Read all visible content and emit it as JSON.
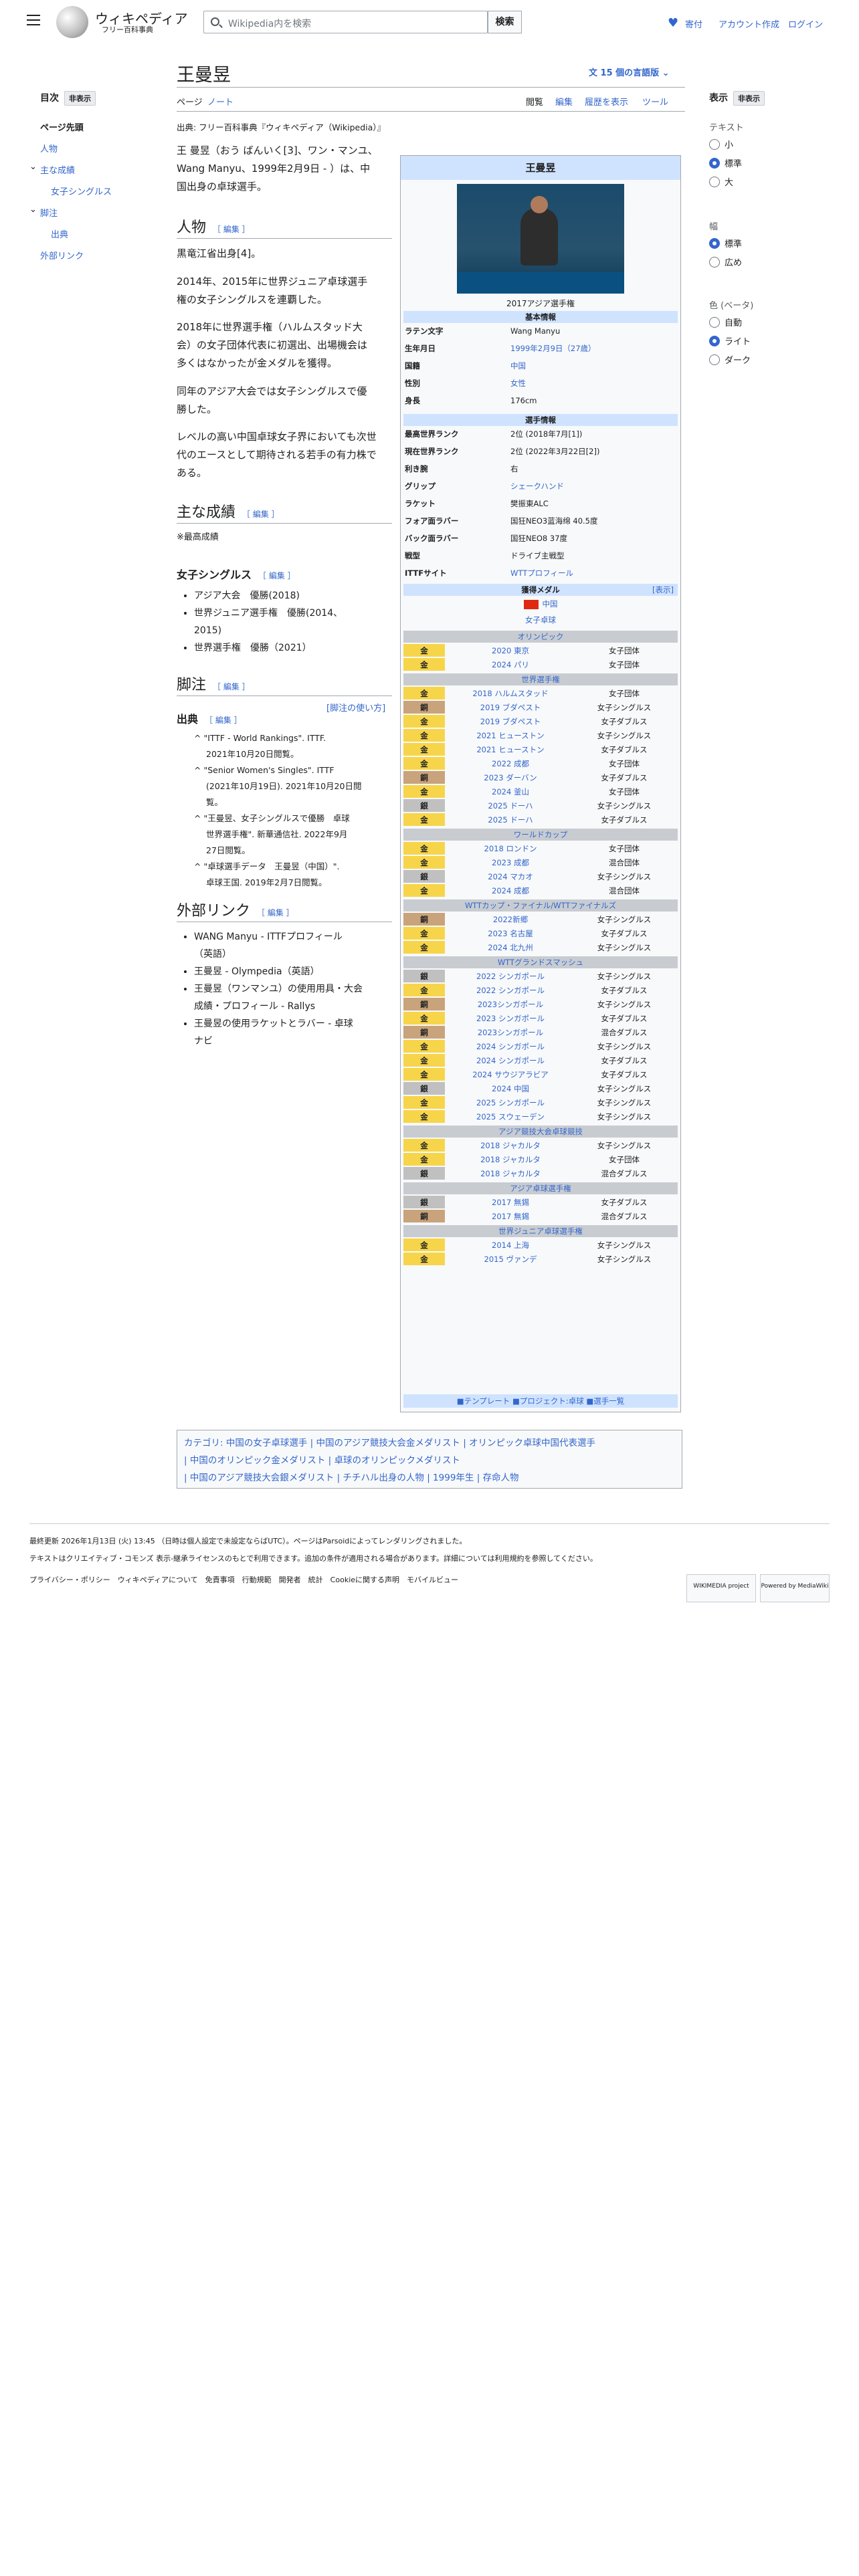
{
  "header": {
    "logo_title": "ウィキペディア",
    "logo_sub": "フリー百科事典",
    "search_placeholder": "Wikipedia内を検索",
    "search_btn": "検索",
    "donate": "寄付",
    "account": "アカウント作成",
    "login": "ログイン"
  },
  "toc": {
    "title": "目次",
    "hide": "非表示",
    "items": [
      "ページ先頭",
      "人物",
      "主な成績",
      "女子シングルス",
      "脚注",
      "出典",
      "外部リンク"
    ]
  },
  "page": {
    "title": "王曼昱",
    "languages": "15 個の言語版",
    "tabs": [
      "ページ",
      "ノート",
      "閲覧",
      "編集",
      "履歴を表示",
      "ツール"
    ],
    "from": "出典: フリー百科事典『ウィキペディア（Wikipedia）』"
  },
  "intro": [
    "王 曼昱（おう ばんいく[3]、ワン・マンユ、",
    "Wang Manyu、1999年2月9日 - ）は、中",
    "国出身の卓球選手。"
  ],
  "sections": {
    "jinbutsu": "人物",
    "edit": "［ 編集 ］",
    "p1": "黒竜江省出身[4]。",
    "p2": [
      "2014年、2015年に世界ジュニア卓球選手",
      "権の女子シングルスを連覇した。"
    ],
    "p3": [
      "2018年に世界選手権（ハルムスタッド大",
      "会）の女子団体代表に初選出、出場機会は",
      "多くはなかったが金メダルを獲得。"
    ],
    "p4": [
      "同年のアジア大会では女子シングルスで優",
      "勝した。"
    ],
    "p5": [
      "レベルの高い中国卓球女子界においても次世",
      "代のエースとして期待される若手の有力株で",
      "ある。"
    ],
    "seiseki": "主な成績",
    "seiseki_note": "※最高成績",
    "singles": "女子シングルス",
    "singles_items": [
      "アジア大会　優勝(2018)",
      "世界ジュニア選手権　優勝(2014、",
      "2015)",
      "世界選手権　優勝（2021）"
    ],
    "kyakuchu": "脚注",
    "shuten": "出典",
    "howto": "[脚注の使い方]",
    "refs": [
      "^ \"ITTF - World Rankings\". ITTF.",
      "2021年10月20日閲覧。",
      "^ \"Senior Women's Singles\". ITTF",
      "(2021年10月19日). 2021年10月20日閲",
      "覧。",
      "^ \"王曼昱、女子シングルスで優勝　卓球",
      "世界選手権\". 新華通信社. 2022年9月",
      "27日閲覧。",
      "^ \"卓球選手データ　王曼昱（中国）\".",
      "卓球王国. 2019年2月7日閲覧。"
    ],
    "links": "外部リンク",
    "link_items": [
      "WANG Manyu - ITTFプロフィール",
      "（英語）",
      "王曼昱 - Olympedia（英語）",
      "王曼昱（ワンマンユ）の使用用具・大会",
      "成績・プロフィール - Rallys",
      "王曼昱の使用ラケットとラバー - 卓球",
      "ナビ"
    ]
  },
  "settings": {
    "title": "表示",
    "hide": "非表示",
    "text": "テキスト",
    "text_opts": [
      "小",
      "標準",
      "大"
    ],
    "width": "幅",
    "width_opts": [
      "標準",
      "広め"
    ],
    "color": "色 (ベータ)",
    "color_opts": [
      "自動",
      "ライト",
      "ダーク"
    ]
  },
  "infobox": {
    "name": "王曼昱",
    "caption": "2017アジア選手権",
    "basic": "基本情報",
    "rows": [
      [
        "ラテン文字",
        "Wang Manyu"
      ],
      [
        "生年月日",
        "1999年2月9日（27歳）"
      ],
      [
        "国籍",
        "中国"
      ],
      [
        "性別",
        "女性"
      ],
      [
        "身長",
        "176cm"
      ]
    ],
    "player": "選手情報",
    "prows": [
      [
        "最高世界ランク",
        "2位 (2018年7月[1])"
      ],
      [
        "現在世界ランク",
        "2位 (2022年3月22日[2])"
      ],
      [
        "利き腕",
        "右"
      ],
      [
        "グリップ",
        "シェークハンド"
      ],
      [
        "ラケット",
        "樊振東ALC"
      ],
      [
        "フォア面ラバー",
        "国狂NEO3蓝海绵 40.5度"
      ],
      [
        "バック面ラバー",
        "国狂NEO8 37度"
      ],
      [
        "戦型",
        "ドライブ主戦型"
      ],
      [
        "ITTFサイト",
        "WTTプロフィール"
      ]
    ],
    "medals": "獲得メダル",
    "show": "[表示]",
    "country": "中国",
    "event": "女子卓球",
    "groups": [
      {
        "name": "オリンピック",
        "rows": [
          [
            "金",
            "2020 東京",
            "女子団体"
          ],
          [
            "金",
            "2024 パリ",
            "女子団体"
          ]
        ]
      },
      {
        "name": "世界選手権",
        "rows": [
          [
            "金",
            "2018 ハルムスタッド",
            "女子団体"
          ],
          [
            "銅",
            "2019 ブダペスト",
            "女子シングルス"
          ],
          [
            "金",
            "2019 ブダペスト",
            "女子ダブルス"
          ],
          [
            "金",
            "2021 ヒューストン",
            "女子シングルス"
          ],
          [
            "金",
            "2021 ヒューストン",
            "女子ダブルス"
          ],
          [
            "金",
            "2022 成都",
            "女子団体"
          ],
          [
            "銅",
            "2023 ダーバン",
            "女子ダブルス"
          ],
          [
            "金",
            "2024 釜山",
            "女子団体"
          ],
          [
            "銀",
            "2025 ドーハ",
            "女子シングルス"
          ],
          [
            "金",
            "2025 ドーハ",
            "女子ダブルス"
          ]
        ]
      },
      {
        "name": "ワールドカップ",
        "rows": [
          [
            "金",
            "2018 ロンドン",
            "女子団体"
          ],
          [
            "金",
            "2023 成都",
            "混合団体"
          ],
          [
            "銀",
            "2024 マカオ",
            "女子シングルス"
          ],
          [
            "金",
            "2024 成都",
            "混合団体"
          ]
        ]
      },
      {
        "name": "WTTカップ・ファイナル/WTTファイナルズ",
        "rows": [
          [
            "銅",
            "2022新郷",
            "女子シングルス"
          ],
          [
            "金",
            "2023 名古屋",
            "女子ダブルス"
          ],
          [
            "金",
            "2024 北九州",
            "女子シングルス"
          ]
        ]
      },
      {
        "name": "WTTグランドスマッシュ",
        "rows": [
          [
            "銀",
            "2022 シンガポール",
            "女子シングルス"
          ],
          [
            "金",
            "2022 シンガポール",
            "女子ダブルス"
          ],
          [
            "銅",
            "2023シンガポール",
            "女子シングルス"
          ],
          [
            "金",
            "2023 シンガポール",
            "女子ダブルス"
          ],
          [
            "銅",
            "2023シンガポール",
            "混合ダブルス"
          ],
          [
            "金",
            "2024 シンガポール",
            "女子シングルス"
          ],
          [
            "金",
            "2024 シンガポール",
            "女子ダブルス"
          ],
          [
            "金",
            "2024 サウジアラビア",
            "女子ダブルス"
          ],
          [
            "銀",
            "2024 中国",
            "女子シングルス"
          ],
          [
            "金",
            "2025 シンガポール",
            "女子シングルス"
          ],
          [
            "金",
            "2025 スウェーデン",
            "女子シングルス"
          ]
        ]
      },
      {
        "name": "アジア競技大会卓球競技",
        "rows": [
          [
            "金",
            "2018 ジャカルタ",
            "女子シングルス"
          ],
          [
            "金",
            "2018 ジャカルタ",
            "女子団体"
          ],
          [
            "銀",
            "2018 ジャカルタ",
            "混合ダブルス"
          ]
        ]
      },
      {
        "name": "アジア卓球選手権",
        "rows": [
          [
            "銀",
            "2017 無錫",
            "女子ダブルス"
          ],
          [
            "銅",
            "2017 無錫",
            "混合ダブルス"
          ]
        ]
      },
      {
        "name": "世界ジュニア卓球選手権",
        "rows": [
          [
            "金",
            "2014 上海",
            "女子シングルス"
          ],
          [
            "金",
            "2015 ヴァンデ",
            "女子シングルス"
          ]
        ]
      }
    ],
    "navbar": "■テンプレート ■プロジェクト:卓球 ■選手一覧"
  },
  "categories": [
    "カテゴリ: 中国の女子卓球選手 | 中国のアジア競技大会金メダリスト | オリンピック卓球中国代表選手",
    "| 中国のオリンピック金メダリスト | 卓球のオリンピックメダリスト",
    "| 中国のアジア競技大会銀メダリスト | チチハル出身の人物 | 1999年生 | 存命人物"
  ],
  "footer": {
    "updated": "最終更新 2026年1月13日 (火) 13:45 （日時は個人設定で未設定ならばUTC）。ページはParsoidによってレンダリングされました。",
    "license": "テキストはクリエイティブ・コモンズ 表示-継承ライセンスのもとで利用できます。追加の条件が適用される場合があります。詳細については利用規約を参照してください。",
    "links": "プライバシー・ポリシー　ウィキペディアについて　免責事項　行動規範　開発者　統計　Cookieに関する声明　モバイルビュー",
    "badge1": "WIKIMEDIA project",
    "badge2": "Powered by MediaWiki"
  }
}
